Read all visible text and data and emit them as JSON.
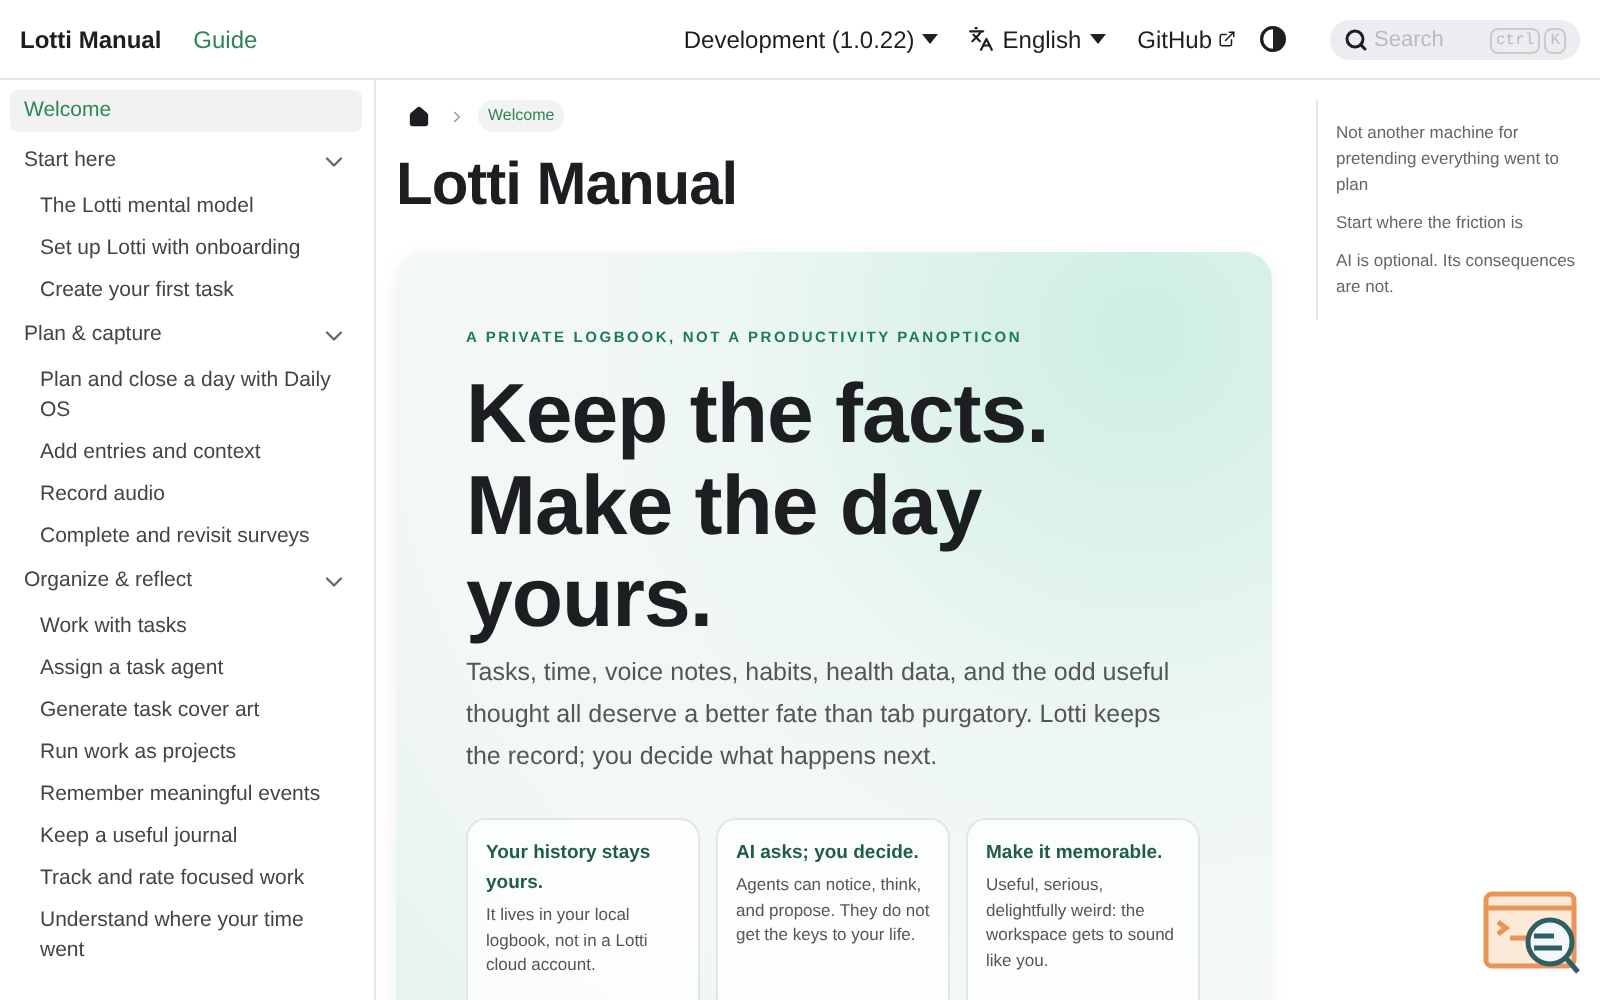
{
  "navbar": {
    "title": "Lotti Manual",
    "links": [
      {
        "label": "Guide",
        "selected": true
      }
    ],
    "version": "Development (1.0.22)",
    "language": "English",
    "github": "GitHub",
    "search": {
      "placeholder": "Search",
      "keys": [
        "ctrl",
        "K"
      ]
    }
  },
  "sidebar": {
    "items": [
      {
        "kind": "link",
        "label": "Welcome",
        "selected": true
      },
      {
        "kind": "category",
        "label": "Start here",
        "expanded": true,
        "children": [
          {
            "label": "The Lotti mental model",
            "selected": false
          },
          {
            "label": "Set up Lotti with onboarding",
            "selected": false
          },
          {
            "label": "Create your first task",
            "selected": false
          }
        ]
      },
      {
        "kind": "category",
        "label": "Plan & capture",
        "expanded": true,
        "children": [
          {
            "label": "Plan and close a day with Daily OS",
            "selected": false
          },
          {
            "label": "Add entries and context",
            "selected": false
          },
          {
            "label": "Record audio",
            "selected": false
          },
          {
            "label": "Complete and revisit surveys",
            "selected": false
          }
        ]
      },
      {
        "kind": "category",
        "label": "Organize & reflect",
        "expanded": true,
        "children": [
          {
            "label": "Work with tasks",
            "selected": false
          },
          {
            "label": "Assign a task agent",
            "selected": false
          },
          {
            "label": "Generate task cover art",
            "selected": false
          },
          {
            "label": "Run work as projects",
            "selected": false
          },
          {
            "label": "Remember meaningful events",
            "selected": false
          },
          {
            "label": "Keep a useful journal",
            "selected": false
          },
          {
            "label": "Track and rate focused work",
            "selected": false
          },
          {
            "label": "Understand where your time went",
            "selected": false
          }
        ]
      }
    ]
  },
  "breadcrumb": {
    "current": "Welcome"
  },
  "page_title": "Lotti Manual",
  "hero": {
    "eyebrow": "A PRIVATE LOGBOOK, NOT A PRODUCTIVITY PANOPTICON",
    "headline": [
      "Keep the facts.",
      "Make the day",
      "yours."
    ],
    "lead": "Tasks, time, voice notes, habits, health data, and the odd useful thought all deserve a better fate than tab purgatory. Lotti keeps the record; you decide what happens next.",
    "cards": [
      {
        "title": "Your history stays yours.",
        "body": "It lives in your local logbook, not in a Lotti cloud account."
      },
      {
        "title": "AI asks; you decide.",
        "body": "Agents can notice, think, and propose. They do not get the keys to your life."
      },
      {
        "title": "Make it memorable.",
        "body": "Useful, serious, delightfully weird: the workspace gets to sound like you."
      }
    ]
  },
  "toc": [
    "Not another machine for pretending everything went to plan",
    "Start where the friction is",
    "AI is optional. Its consequences are not."
  ]
}
